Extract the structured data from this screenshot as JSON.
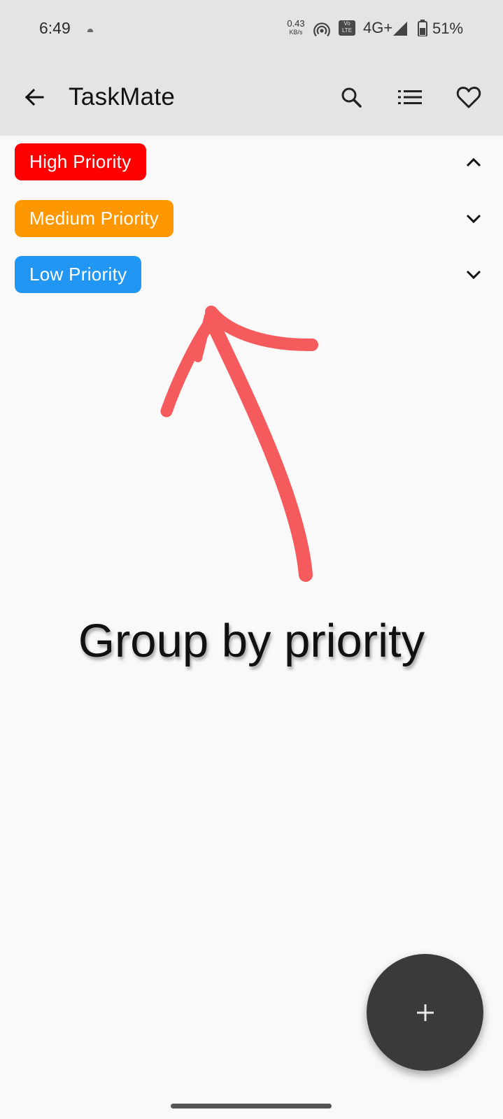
{
  "status_bar": {
    "time": "6:49",
    "net_speed_value": "0.43",
    "net_speed_unit": "KB/s",
    "volte_top": "Vo",
    "volte_bottom": "LTE",
    "network_type": "4G+",
    "battery_percent": "51%"
  },
  "app_bar": {
    "title": "TaskMate",
    "icons": {
      "back": "arrow-back-icon",
      "search": "search-icon",
      "list": "list-icon",
      "favorite": "heart-icon"
    }
  },
  "priority_groups": [
    {
      "label": "High Priority",
      "color": "#ff0000",
      "expanded": true
    },
    {
      "label": "Medium Priority",
      "color": "#ff9800",
      "expanded": false
    },
    {
      "label": "Low Priority",
      "color": "#2196f3",
      "expanded": false
    }
  ],
  "annotation": {
    "caption": "Group by priority",
    "arrow_color": "#f55a5c"
  },
  "fab": {
    "icon": "plus-icon"
  }
}
